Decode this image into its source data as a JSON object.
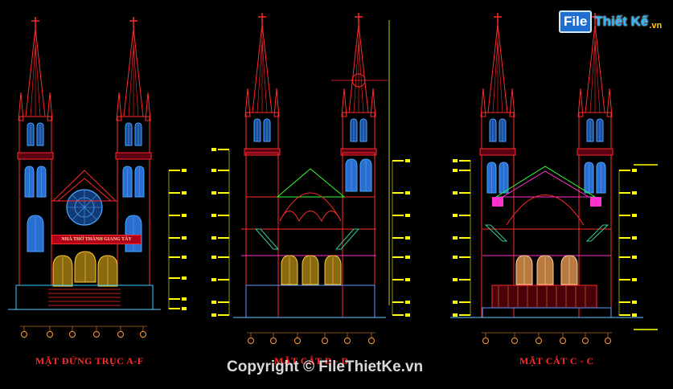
{
  "drawings": [
    {
      "id": "elevation-a-f",
      "label": "MẶT ĐỨNG TRỤC A-F",
      "banner": "NHÀ THỜ THÁNH GIANG TÂY"
    },
    {
      "id": "section-d-d",
      "label": "MẶT CẮT D - D"
    },
    {
      "id": "section-c-c",
      "label": "MẶT CẮT C - C"
    }
  ],
  "logo": {
    "part1": "File",
    "part2": "Thiết Kế",
    "part3": ".vn"
  },
  "copyright": "Copyright © FileThietKe.vn",
  "colors": {
    "background": "#000000",
    "outline": "#ff2a2a",
    "window": "#4aa3ff",
    "dimension": "#ffff00",
    "roof": "#33ff33",
    "stairs": "#33cc99",
    "magenta": "#ff33cc",
    "orange": "#ff9933"
  }
}
